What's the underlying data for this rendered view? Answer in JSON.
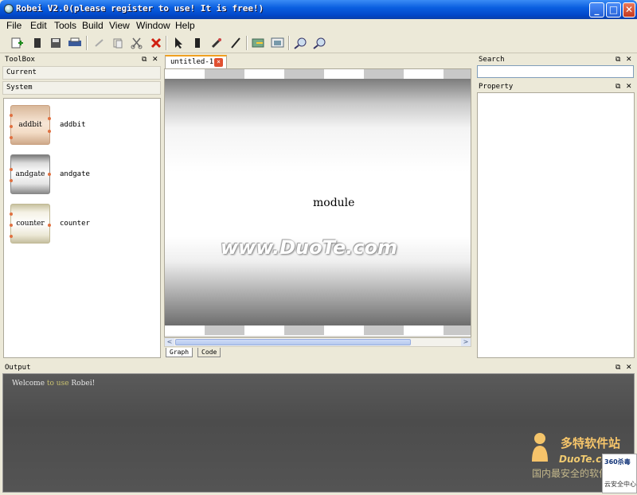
{
  "window": {
    "title": "Robei V2.0(please register to use! It is free!)",
    "min": "_",
    "max": "□",
    "close": "✕"
  },
  "menu": [
    "File",
    "Edit",
    "Tools",
    "Build",
    "View",
    "Window",
    "Help"
  ],
  "toolbar": {
    "icons": [
      "new-file-icon",
      "open-icon",
      "save-icon",
      "print-icon",
      "undo-icon",
      "copy-icon",
      "cut-icon",
      "delete-icon",
      "pointer-icon",
      "module-icon",
      "pin-icon",
      "wire-icon",
      "compile-icon",
      "simulate-icon",
      "zoom-in-icon",
      "zoom-out-icon"
    ]
  },
  "toolbox": {
    "title": "ToolBox",
    "sections": {
      "current": "Current",
      "system": "System"
    },
    "items": [
      {
        "icon_text": "addbit",
        "label": "addbit"
      },
      {
        "icon_text": "andgate",
        "label": "andgate"
      },
      {
        "icon_text": "counter",
        "label": "counter"
      }
    ]
  },
  "panel_ctl": {
    "float": "⧉",
    "close": "✕"
  },
  "editor": {
    "tab_label": "untitled-1",
    "tab_close": "×",
    "module_name": "module",
    "watermark": "www.DuoTe.com",
    "bottom_tabs": [
      "Graph",
      "Code"
    ],
    "scroll_left": "<",
    "scroll_right": ">"
  },
  "search": {
    "title": "Search",
    "value": ""
  },
  "property": {
    "title": "Property"
  },
  "output": {
    "title": "Output",
    "text_before": "Welcome ",
    "text_highlight": "to use",
    "text_after": " Robei!"
  },
  "corner_watermark": {
    "brand": "多特软件站",
    "brand_en": "DuoTe.com",
    "tagline": "国内最安全的软件站"
  },
  "notification": {
    "line1": "360杀毒",
    "line2": "云安全中心"
  },
  "colors": {
    "title_blue": "#0a5fe0",
    "tab_accent": "#f0a020",
    "output_bg": "#545454",
    "watermark_orange": "#f6c56a"
  }
}
